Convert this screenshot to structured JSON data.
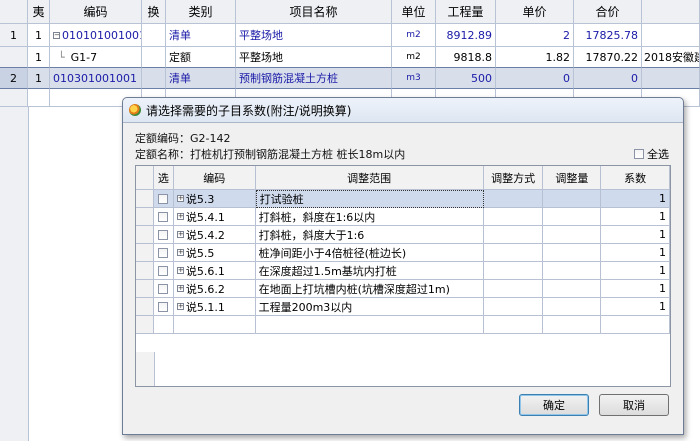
{
  "background_table": {
    "headers": [
      "",
      "夷",
      "编码",
      "换",
      "类别",
      "项目名称",
      "单位",
      "工程量",
      "单价",
      "合价",
      ""
    ],
    "rows": [
      {
        "row_no": "1",
        "sub": "1",
        "code": "010101001001",
        "type": "清单",
        "name": "平整场地",
        "unit": "m2",
        "qty": "8912.89",
        "price": "2",
        "total": "17825.78",
        "extra": ""
      },
      {
        "row_no": "",
        "sub": "1",
        "code": "G1-7",
        "type": "定额",
        "name": "平整场地",
        "unit": "m2",
        "qty": "9818.8",
        "price": "1.82",
        "total": "17870.22",
        "extra": "2018安徽建设"
      },
      {
        "row_no": "2",
        "sub": "1",
        "code": "010301001001",
        "type": "清单",
        "name": "预制钢筋混凝土方桩",
        "unit": "m3",
        "qty": "500",
        "price": "0",
        "total": "0",
        "extra": ""
      }
    ]
  },
  "dialog": {
    "title": "请选择需要的子目系数(附注/说明换算)",
    "quota_code": "定额编码：G2-142",
    "quota_name": "定额名称：打桩机打预制钢筋混凝土方桩 桩长18m以内",
    "select_all_label": "全选",
    "columns": [
      "选",
      "编码",
      "调整范围",
      "调整方式",
      "调整量",
      "系数"
    ],
    "rows": [
      {
        "code": "说5.3",
        "range": "打试验桩",
        "method": "",
        "amount": "",
        "coef": "1"
      },
      {
        "code": "说5.4.1",
        "range": "打斜桩，斜度在1:6以内",
        "method": "",
        "amount": "",
        "coef": "1"
      },
      {
        "code": "说5.4.2",
        "range": "打斜桩，斜度大于1:6",
        "method": "",
        "amount": "",
        "coef": "1"
      },
      {
        "code": "说5.5",
        "range": "桩净间距小于4倍桩径(桩边长)",
        "method": "",
        "amount": "",
        "coef": "1"
      },
      {
        "code": "说5.6.1",
        "range": "在深度超过1.5m基坑内打桩",
        "method": "",
        "amount": "",
        "coef": "1"
      },
      {
        "code": "说5.6.2",
        "range": "在地面上打坑槽内桩(坑槽深度超过1m)",
        "method": "",
        "amount": "",
        "coef": "1"
      },
      {
        "code": "说5.1.1",
        "range": "工程量200m3以内",
        "method": "",
        "amount": "",
        "coef": "1"
      }
    ],
    "ok_label": "确定",
    "cancel_label": "取消"
  },
  "colors": {
    "link_blue": "#1a1aa8",
    "selected_row": "#cfdaed",
    "dialog_bg": "#f0f0f0"
  },
  "icons": [
    "app-logo-icon",
    "expand-plus-icon",
    "tree-collapse-icon"
  ]
}
